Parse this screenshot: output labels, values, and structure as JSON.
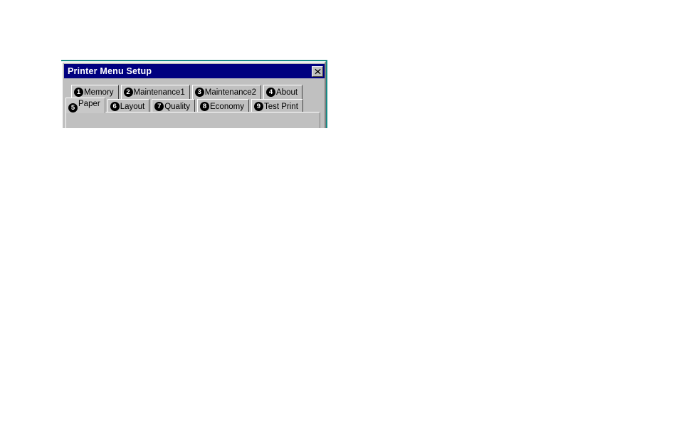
{
  "window": {
    "title": "Printer Menu Setup",
    "close_label": "×",
    "close_icon": "close-icon"
  },
  "tabs": {
    "row1": [
      {
        "number": "1",
        "label": "Memory",
        "selected": false
      },
      {
        "number": "2",
        "label": "Maintenance1",
        "selected": false
      },
      {
        "number": "3",
        "label": "Maintenance2",
        "selected": false
      },
      {
        "number": "4",
        "label": "About",
        "selected": false
      }
    ],
    "row2": [
      {
        "number": "5",
        "label": "Paper",
        "selected": true
      },
      {
        "number": "6",
        "label": "Layout",
        "selected": false
      },
      {
        "number": "7",
        "label": "Quality",
        "selected": false
      },
      {
        "number": "8",
        "label": "Economy",
        "selected": false
      },
      {
        "number": "9",
        "label": "Test Print",
        "selected": false
      }
    ]
  },
  "colors": {
    "titlebar": "#000080",
    "titlebar_text": "#ffffff",
    "face": "#c0c0c0",
    "shadow": "#808080",
    "highlight": "#ffffff",
    "badge": "#000000"
  }
}
